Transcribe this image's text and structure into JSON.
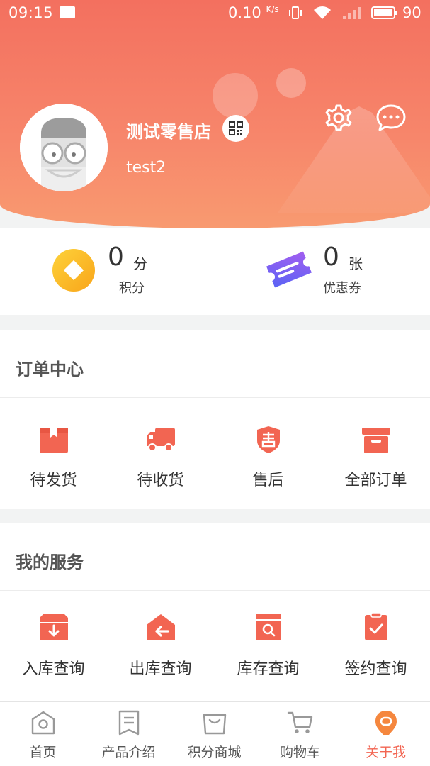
{
  "status_bar": {
    "time": "09:15",
    "net_speed": "0.10",
    "net_speed_unit": "K/s",
    "battery": "90"
  },
  "profile": {
    "store_name": "测试零售店",
    "username": "test2"
  },
  "stats": {
    "points": {
      "value": "0",
      "unit": "分",
      "label": "积分"
    },
    "coupons": {
      "value": "0",
      "unit": "张",
      "label": "优惠券"
    }
  },
  "orders": {
    "title": "订单中心",
    "items": [
      {
        "label": "待发货",
        "icon": "package-icon"
      },
      {
        "label": "待收货",
        "icon": "truck-icon"
      },
      {
        "label": "售后",
        "icon": "after-sale-shield-icon"
      },
      {
        "label": "全部订单",
        "icon": "archive-box-icon"
      }
    ]
  },
  "services": {
    "title": "我的服务",
    "items": [
      {
        "label": "入库查询",
        "icon": "inbound-box-icon"
      },
      {
        "label": "出库查询",
        "icon": "outbound-house-icon"
      },
      {
        "label": "库存查询",
        "icon": "inventory-search-icon"
      },
      {
        "label": "签约查询",
        "icon": "clipboard-check-icon"
      }
    ]
  },
  "tabbar": {
    "items": [
      {
        "label": "首页",
        "icon": "home-icon"
      },
      {
        "label": "产品介绍",
        "icon": "product-doc-icon"
      },
      {
        "label": "积分商城",
        "icon": "shopping-bag-icon"
      },
      {
        "label": "购物车",
        "icon": "cart-icon"
      },
      {
        "label": "关于我",
        "icon": "about-me-icon",
        "active": true
      }
    ]
  },
  "colors": {
    "header_start": "#f3705f",
    "header_end": "#f89a70",
    "accent": "#f26552",
    "points_gold": "#fbb21d",
    "coupon_purple": "#7b5cf0"
  }
}
